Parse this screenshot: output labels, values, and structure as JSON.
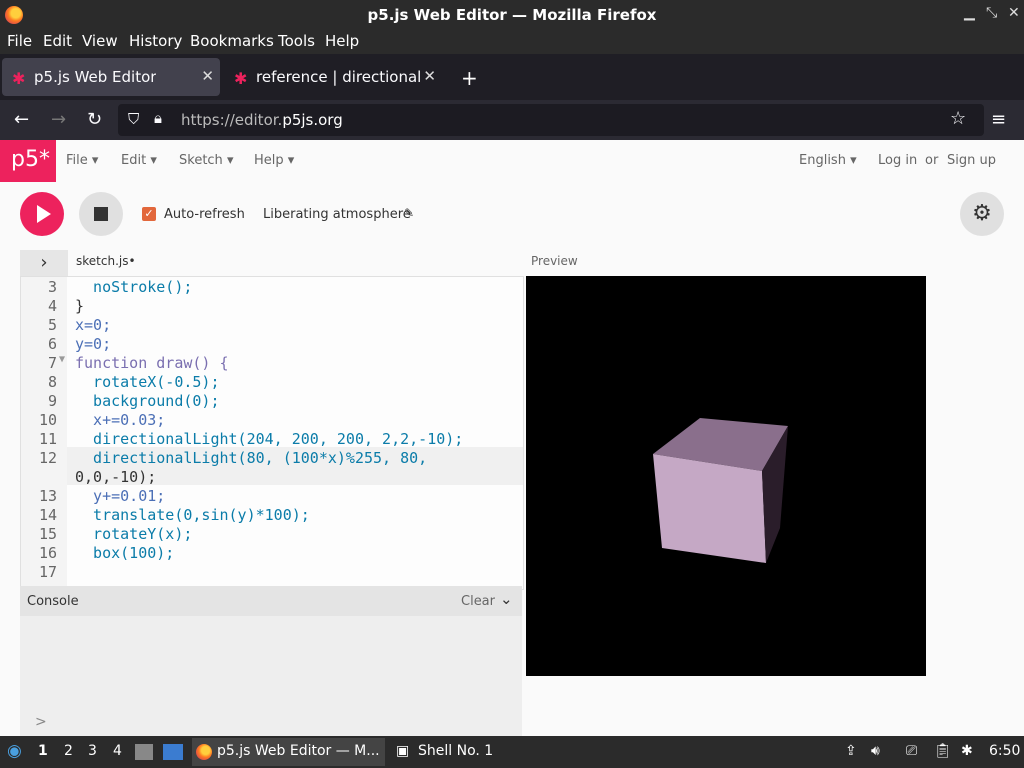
{
  "window": {
    "title": "p5.js Web Editor — Mozilla Firefox"
  },
  "menubar": [
    "File",
    "Edit",
    "View",
    "History",
    "Bookmarks",
    "Tools",
    "Help"
  ],
  "tabs": [
    {
      "label": "p5.js Web Editor"
    },
    {
      "label": "reference | directionalLig"
    }
  ],
  "url": {
    "prefix": "https://editor.",
    "domain": "p5js.org"
  },
  "p5nav": {
    "logo": "p5*",
    "items": [
      "File",
      "Edit",
      "Sketch",
      "Help"
    ],
    "language": "English",
    "login": "Log in",
    "or": "or",
    "signup": "Sign up"
  },
  "toolbar": {
    "auto_refresh": "Auto-refresh",
    "sketch_name": "Liberating atmosphere"
  },
  "editor": {
    "file_tab": "sketch.js",
    "preview_label": "Preview",
    "line_numbers": [
      "3",
      "4",
      "5",
      "6",
      "7",
      "8",
      "9",
      "10",
      "11",
      "12",
      "13",
      "14",
      "15",
      "16",
      "17"
    ],
    "lines": [
      "  noStroke();",
      "}",
      "x=0;",
      "y=0;",
      "function draw() {",
      "  rotateX(-0.5);",
      "  background(0);",
      "  x+=0.03;",
      "  directionalLight(204, 200, 200, 2,2,-10);",
      "  directionalLight(80, (100*x)%255, 80,",
      "0,0,-10);",
      "  y+=0.01;",
      "  translate(0,sin(y)*100);",
      "  rotateY(x);",
      "  box(100);"
    ]
  },
  "console": {
    "label": "Console",
    "clear": "Clear",
    "prompt": ">"
  },
  "taskbar": {
    "workspaces": [
      "1",
      "2",
      "3",
      "4"
    ],
    "firefox_task": "p5.js Web Editor — M...",
    "shell_task": "Shell No. 1",
    "clock": "6:50"
  }
}
